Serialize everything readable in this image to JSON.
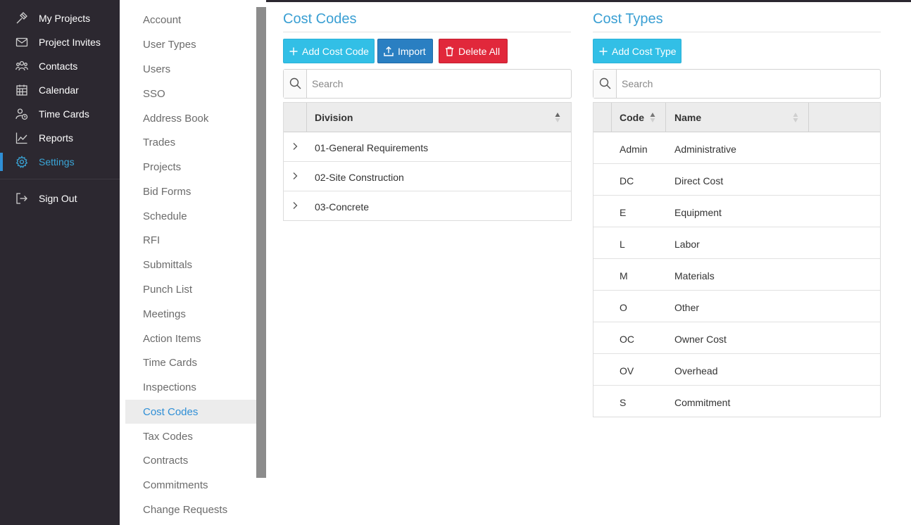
{
  "nav": {
    "items": [
      {
        "label": "My Projects",
        "icon": "hammer-icon"
      },
      {
        "label": "Project Invites",
        "icon": "envelope-icon"
      },
      {
        "label": "Contacts",
        "icon": "users-icon"
      },
      {
        "label": "Calendar",
        "icon": "calendar-icon"
      },
      {
        "label": "Time Cards",
        "icon": "user-clock-icon"
      },
      {
        "label": "Reports",
        "icon": "line-chart-icon"
      },
      {
        "label": "Settings",
        "icon": "gear-icon",
        "active": true
      }
    ],
    "sign_out": {
      "label": "Sign Out",
      "icon": "sign-out-icon"
    }
  },
  "settings_menu": {
    "items": [
      "Account",
      "User Types",
      "Users",
      "SSO",
      "Address Book",
      "Trades",
      "Projects",
      "Bid Forms",
      "Schedule",
      "RFI",
      "Submittals",
      "Punch List",
      "Meetings",
      "Action Items",
      "Time Cards",
      "Inspections",
      "Cost Codes",
      "Tax Codes",
      "Contracts",
      "Commitments",
      "Change Requests"
    ],
    "active": "Cost Codes"
  },
  "cost_codes": {
    "title": "Cost Codes",
    "add_label": "Add Cost Code",
    "import_label": "Import",
    "delete_all_label": "Delete All",
    "search_placeholder": "Search",
    "column_division": "Division",
    "rows": [
      "01-General Requirements",
      "02-Site Construction",
      "03-Concrete"
    ]
  },
  "cost_types": {
    "title": "Cost Types",
    "add_label": "Add Cost Type",
    "search_placeholder": "Search",
    "column_code": "Code",
    "column_name": "Name",
    "rows": [
      {
        "code": "Admin",
        "name": "Administrative"
      },
      {
        "code": "DC",
        "name": "Direct Cost"
      },
      {
        "code": "E",
        "name": "Equipment"
      },
      {
        "code": "L",
        "name": "Labor"
      },
      {
        "code": "M",
        "name": "Materials"
      },
      {
        "code": "O",
        "name": "Other"
      },
      {
        "code": "OC",
        "name": "Owner Cost"
      },
      {
        "code": "OV",
        "name": "Overhead"
      },
      {
        "code": "S",
        "name": "Commitment"
      }
    ]
  },
  "colors": {
    "nav_bg": "#2c2830",
    "accent": "#3a9fd3",
    "button_cyan": "#32bfe6",
    "button_blue": "#2a7fc2",
    "button_red": "#e1283b"
  }
}
